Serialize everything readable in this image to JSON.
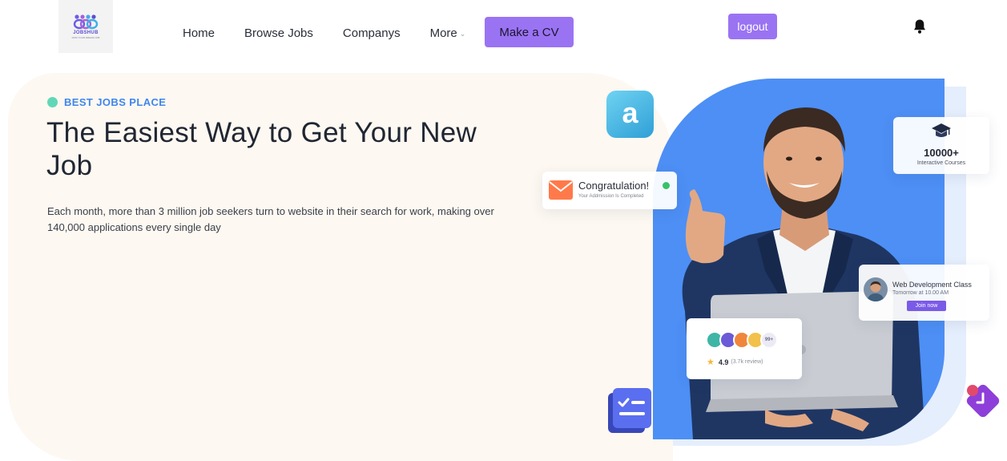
{
  "header": {
    "logo_text": "JOBSHUB",
    "logo_tagline": "FIND YOUR DREAM JOB",
    "nav": [
      {
        "label": "Home"
      },
      {
        "label": "Browse Jobs"
      },
      {
        "label": "Companys"
      },
      {
        "label": "More"
      }
    ],
    "cv_button": "Make a CV",
    "logout_button": "logout",
    "icons": {
      "bell": "bell-icon",
      "more_chevron": "chevron-down-icon"
    }
  },
  "hero": {
    "tag": "BEST JOBS PLACE",
    "headline": "The Easiest Way to Get Your New Job",
    "description": "Each month, more than 3 million job seekers turn to website in their search for work, making over 140,000 applications every single day"
  },
  "cards": {
    "congrats": {
      "title": "Congratulation!",
      "subtitle": "Your Addmission Is Completed"
    },
    "courses": {
      "count": "10000+",
      "label": "Interactive Courses"
    },
    "webdev": {
      "title": "Web Development Class",
      "time": "Tomorrow at 10.00 AM",
      "button": "Join now"
    },
    "reviews": {
      "count_badge": "99+",
      "rating": "4.9",
      "review_count": "(3.7k review)"
    }
  },
  "colors": {
    "accent": "#9a73f3",
    "hero_bg": "#fdf8f1",
    "blue": "#4d8ff5",
    "tag": "#3f86ee",
    "tag_dot": "#62d7b8"
  }
}
